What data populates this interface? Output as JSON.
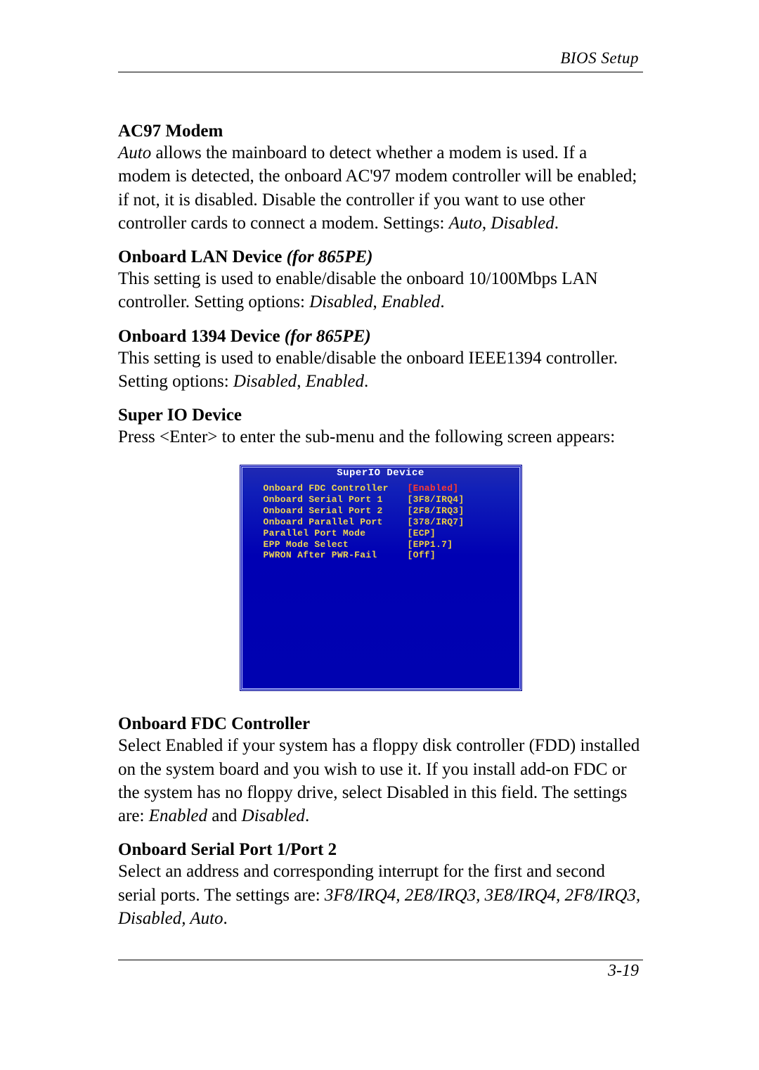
{
  "header": {
    "running_head": "BIOS Setup"
  },
  "sections": {
    "ac97": {
      "heading": "AC97 Modem",
      "body_prefix_ital": "Auto",
      "body1": " allows the mainboard to detect whether a modem is used.  If a modem is detected, the onboard AC'97 modem controller will be enabled; if not, it is disabled.  Disable the controller if you want to use other controller cards to connect a modem.  Settings: ",
      "body_set_ital": "Auto",
      "body_sep": ", ",
      "body_set2_ital": "Disabled",
      "body_end": "."
    },
    "lan": {
      "heading_plain": "Onboard LAN Device ",
      "heading_ital": "(for 865PE)",
      "body_pre": "This setting is used to enable/disable the onboard 10/100Mbps LAN controller.  Setting options: ",
      "opt1": "Disabled",
      "sep": ", ",
      "opt2": "Enabled",
      "end": "."
    },
    "ieee1394": {
      "heading_plain": "Onboard 1394 Device ",
      "heading_ital": "(for 865PE)",
      "body_pre": "This setting is used to enable/disable the onboard IEEE1394 controller. Setting options: ",
      "opt1": "Disabled",
      "sep": ", ",
      "opt2": "Enabled",
      "end": "."
    },
    "superio": {
      "heading": "Super IO Device",
      "body": "Press <Enter> to enter the sub-menu and the following screen appears:"
    },
    "fdc": {
      "heading": "Onboard FDC Controller",
      "body_pre": "Select Enabled if your system has a floppy disk controller (FDD) installed on the system board and you wish to use it. If you install add-on FDC or the system has no floppy drive, select Disabled in this field. The settings are: ",
      "opt1": "Enabled",
      "mid": " and  ",
      "opt2": "Disabled",
      "end": "."
    },
    "serial": {
      "heading": "Onboard Serial Port 1/Port 2",
      "body_pre": "Select an address and corresponding interrupt for the first and second serial ports. The settings are: ",
      "opts": "3F8/IRQ4, 2E8/IRQ3, 3E8/IRQ4, 2F8/IRQ3, Disabled, Auto",
      "end": "."
    }
  },
  "bios": {
    "title": "SuperIO Device",
    "rows": [
      {
        "label": "Onboard FDC Controller",
        "value": "[Enabled]",
        "highlight": true
      },
      {
        "label": "Onboard Serial Port 1",
        "value": "[3F8/IRQ4]",
        "highlight": false
      },
      {
        "label": "Onboard Serial Port 2",
        "value": "[2F8/IRQ3]",
        "highlight": false
      },
      {
        "label": "Onboard Parallel Port",
        "value": "[378/IRQ7]",
        "highlight": false
      },
      {
        "label": "Parallel Port Mode",
        "value": "[ECP]",
        "highlight": false
      },
      {
        "label": "EPP Mode Select",
        "value": "[EPP1.7]",
        "highlight": false
      },
      {
        "label": "PWRON After PWR-Fail",
        "value": "[Off]",
        "highlight": false
      }
    ]
  },
  "footer": {
    "page_number": "3-19"
  }
}
